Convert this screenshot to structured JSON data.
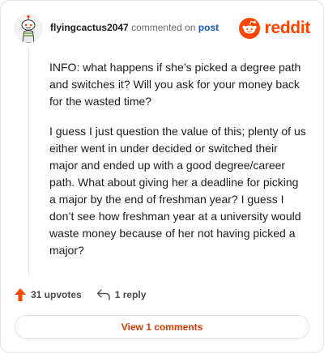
{
  "header": {
    "username": "flyingcactus2047",
    "action_text": "commented on",
    "post_link": "post",
    "brand_name": "reddit"
  },
  "comment": {
    "paragraphs": [
      "INFO: what happens if she’s picked a degree path and switches it? Will you ask for your money back for the wasted time?",
      "I guess I just question the value of this; plenty of us either went in under decided or switched their major and ended up with a good degree/career path. What about giving her a deadline for picking a major by the end of freshman year? I guess I don’t see how freshman year at a university would waste money because of her not having picked a major?"
    ]
  },
  "actions": {
    "upvotes_label": "31 upvotes",
    "replies_label": "1 reply"
  },
  "footer": {
    "view_comments_label": "View 1 comments"
  },
  "colors": {
    "brand": "#ff4500",
    "link": "#1a56c4",
    "view_button_text": "#d93a00",
    "border": "#e3e3e3"
  },
  "icons": {
    "avatar": "avatar-icon",
    "brand": "reddit-logo-icon",
    "upvote": "upvote-arrow-icon",
    "reply": "reply-arrow-icon"
  }
}
